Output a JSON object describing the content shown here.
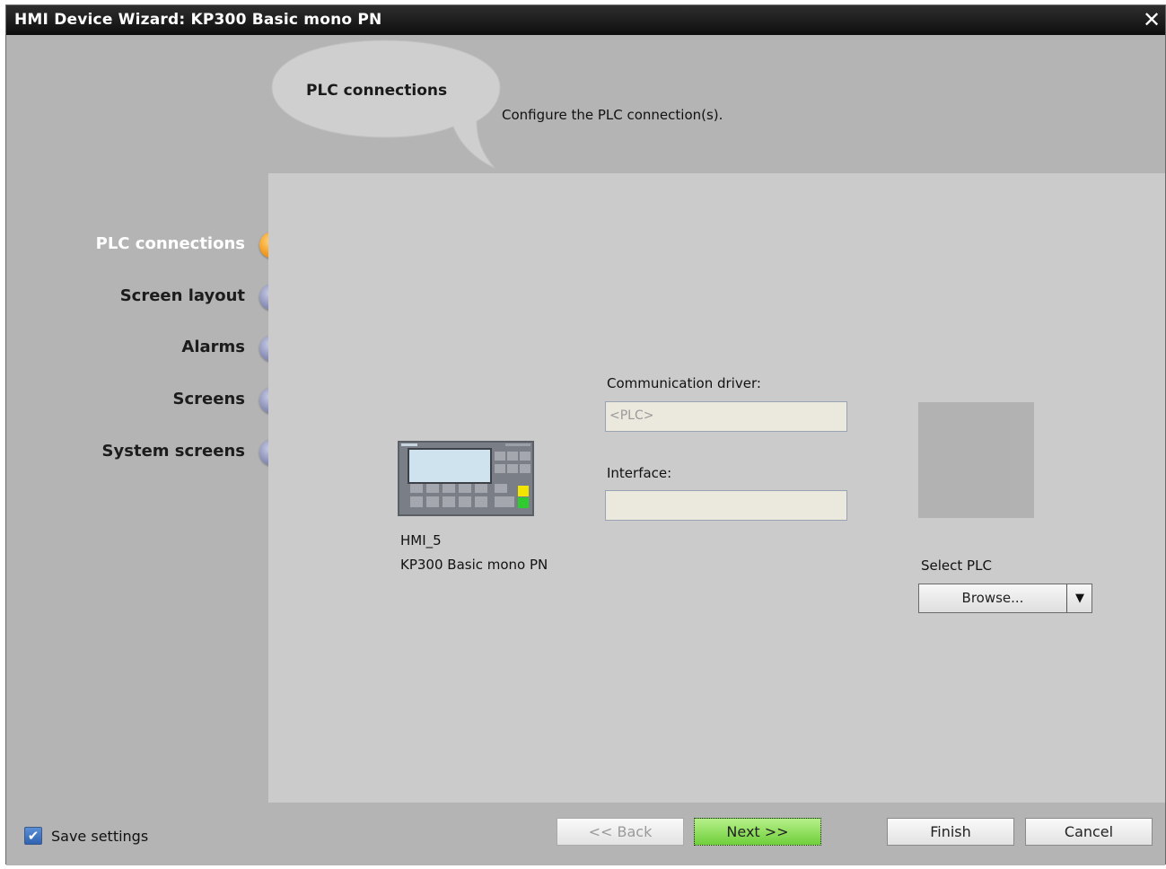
{
  "window": {
    "title": "HMI Device Wizard: KP300 Basic mono PN",
    "close_glyph": "✕"
  },
  "header": {
    "bubble_title": "PLC connections",
    "description": "Configure the PLC connection(s)."
  },
  "sidebar": {
    "steps": [
      {
        "label": "PLC connections",
        "active": true
      },
      {
        "label": "Screen layout",
        "active": false
      },
      {
        "label": "Alarms",
        "active": false
      },
      {
        "label": "Screens",
        "active": false
      },
      {
        "label": "System screens",
        "active": false
      }
    ]
  },
  "device": {
    "name": "HMI_5",
    "type": "KP300 Basic mono PN"
  },
  "form": {
    "driver_label": "Communication driver:",
    "driver_value": "<PLC>",
    "interface_label": "Interface:",
    "interface_value": "",
    "select_plc_label": "Select PLC",
    "browse_label": "Browse..."
  },
  "footer": {
    "save_settings_label": "Save settings",
    "save_settings_checked": true,
    "back_label": "<< Back",
    "next_label": "Next >>",
    "finish_label": "Finish",
    "cancel_label": "Cancel"
  },
  "colors": {
    "active_step": "#f49a1c",
    "inactive_step": "#8a90b8",
    "next_button": "#6fcf3a"
  }
}
